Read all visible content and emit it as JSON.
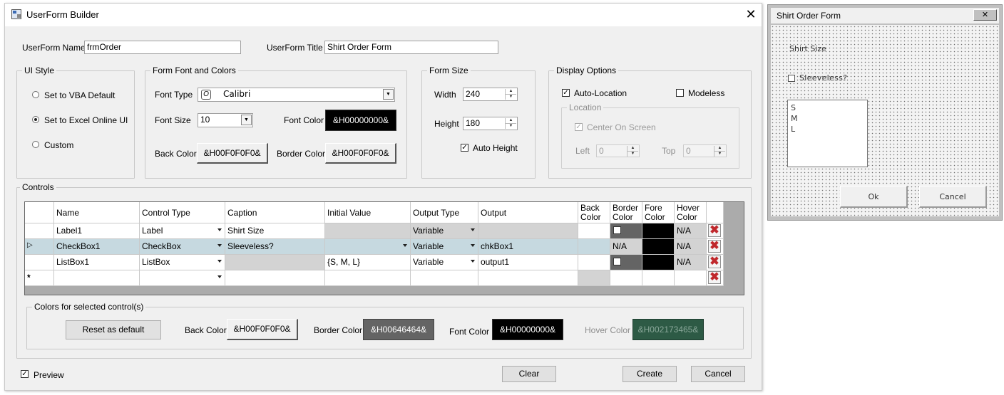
{
  "window": {
    "title": "UserForm Builder",
    "close_glyph": "✕"
  },
  "top": {
    "name_label": "UserForm Name",
    "name_value": "frmOrder",
    "title_label": "UserForm Title",
    "title_value": "Shirt Order Form"
  },
  "ui_style": {
    "title": "UI Style",
    "options": [
      {
        "label": "Set to VBA Default",
        "selected": false
      },
      {
        "label": "Set to Excel Online UI",
        "selected": true
      },
      {
        "label": "Custom",
        "selected": false
      }
    ]
  },
  "font_colors": {
    "title": "Form Font and Colors",
    "font_type_label": "Font Type",
    "font_type_value": "Calibri",
    "font_size_label": "Font Size",
    "font_size_value": "10",
    "font_color_label": "Font Color",
    "font_color_value": "&H00000000&",
    "back_color_label": "Back Color",
    "back_color_value": "&H00F0F0F0&",
    "border_color_label": "Border Color",
    "border_color_value": "&H00F0F0F0&"
  },
  "form_size": {
    "title": "Form Size",
    "width_label": "Width",
    "width_value": "240",
    "height_label": "Height",
    "height_value": "180",
    "auto_height_label": "Auto Height",
    "auto_height_checked": true
  },
  "display": {
    "title": "Display Options",
    "auto_location_label": "Auto-Location",
    "auto_location_checked": true,
    "modeless_label": "Modeless",
    "modeless_checked": false,
    "location_title": "Location",
    "center_label": "Center On Screen",
    "center_checked": true,
    "left_label": "Left",
    "left_value": "0",
    "top_label": "Top",
    "top_value": "0"
  },
  "controls": {
    "title": "Controls",
    "headers": {
      "name": "Name",
      "control_type": "Control Type",
      "caption": "Caption",
      "initial_value": "Initial Value",
      "output_type": "Output Type",
      "output": "Output",
      "back_color_1": "Back",
      "back_color_2": "Color",
      "border_color_1": "Border",
      "border_color_2": "Color",
      "fore_color_1": "Fore",
      "fore_color_2": "Color",
      "hover_color_1": "Hover",
      "hover_color_2": "Color"
    },
    "rows": [
      {
        "name": "Label1",
        "type": "Label",
        "caption": "Shirt Size",
        "initial": "",
        "output_type": "Variable",
        "output": "",
        "border": "",
        "hover": "N/A"
      },
      {
        "name": "CheckBox1",
        "type": "CheckBox",
        "caption": "Sleeveless?",
        "initial": "",
        "output_type": "Variable",
        "output": "chkBox1",
        "border": "N/A",
        "hover": "N/A"
      },
      {
        "name": "ListBox1",
        "type": "ListBox",
        "caption": "",
        "initial": "{S, M, L}",
        "output_type": "Variable",
        "output": "output1",
        "border": "",
        "hover": "N/A"
      }
    ],
    "new_row_marker": "*",
    "delete_glyph": "✖"
  },
  "selected_colors": {
    "title": "Colors for selected control(s)",
    "reset_label": "Reset as default",
    "back_label": "Back Color",
    "back_value": "&H00F0F0F0&",
    "border_label": "Border Color",
    "border_value": "&H00646464&",
    "font_label": "Font Color",
    "font_value": "&H00000000&",
    "hover_label": "Hover Color",
    "hover_value": "&H002173465&"
  },
  "bottom": {
    "preview_label": "Preview",
    "preview_checked": true,
    "clear_label": "Clear",
    "create_label": "Create",
    "cancel_label": "Cancel"
  },
  "preview_form": {
    "title": "Shirt Order Form",
    "close_glyph": "✕",
    "label_text": "Shirt Size",
    "checkbox_text": "Sleeveless?",
    "list_items": [
      "S",
      "M",
      "L"
    ],
    "ok_label": "Ok",
    "cancel_label": "Cancel"
  },
  "colors": {
    "black": "#000000",
    "border_gray": "#646464",
    "hover_green": "#2d5a45",
    "selected_row": "#c6d9e0",
    "delete_red": "#c0282c"
  }
}
